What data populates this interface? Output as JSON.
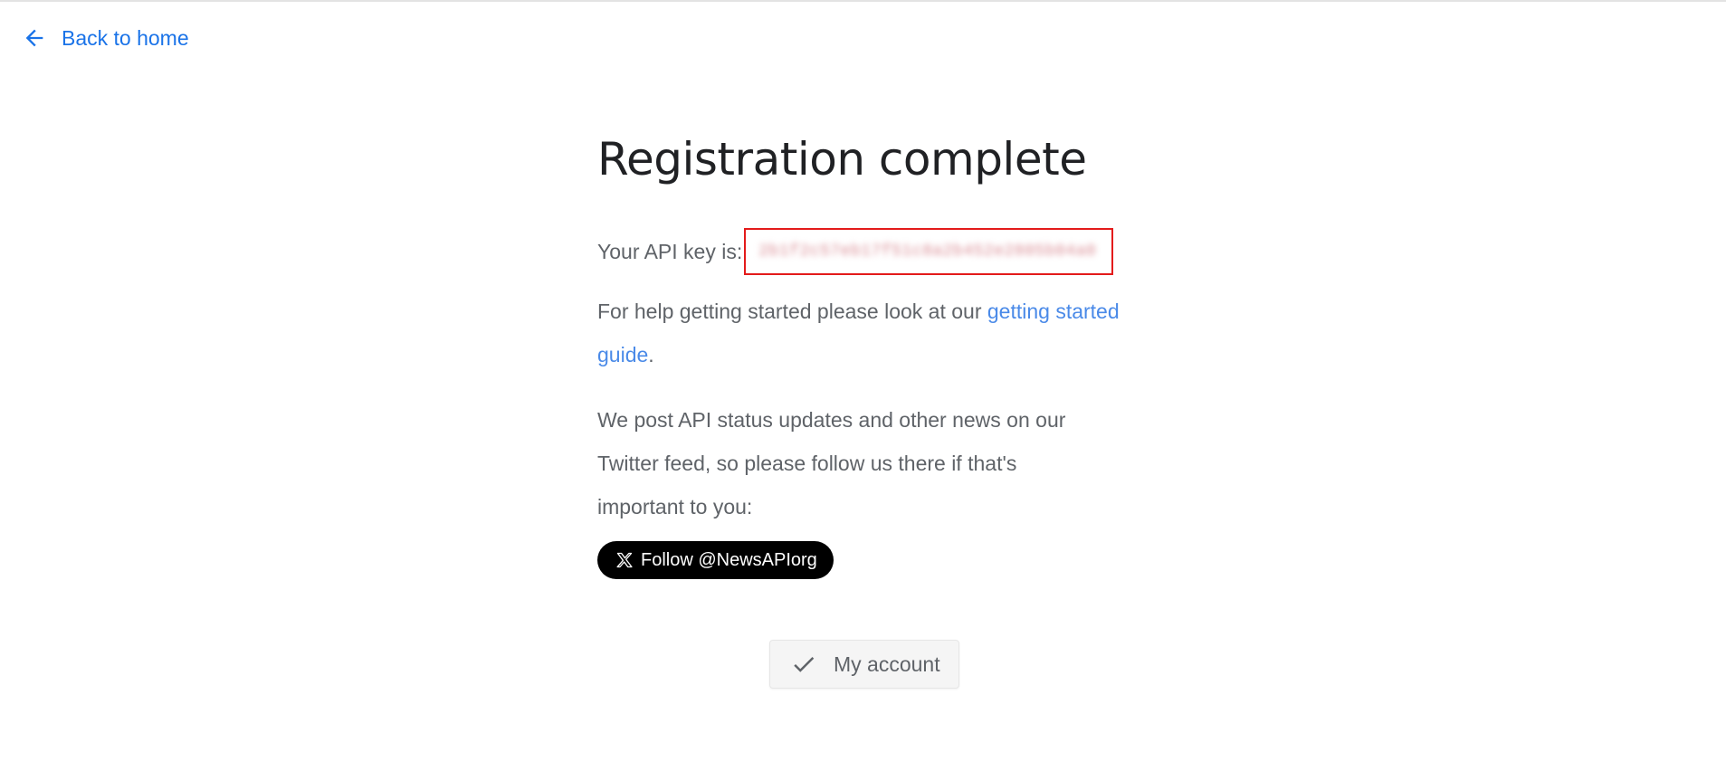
{
  "nav": {
    "back_label": "Back to home",
    "back_icon": "arrow-left-icon"
  },
  "main": {
    "title": "Registration complete",
    "api_key_label": "Your API key is:",
    "api_key_value": "2b1f2c57eb17f51c8a2b452e2805b04a0",
    "help_prefix": "For help getting started please look at our ",
    "help_link": "getting started guide",
    "help_suffix": ".",
    "news_text": "We post API status updates and other news on our Twitter feed, so please follow us there if that's important to you:",
    "follow_label": "Follow @NewsAPIorg",
    "follow_icon": "x-logo-icon",
    "account_label": "My account",
    "account_icon": "check-icon"
  },
  "colors": {
    "link": "#1a73e8",
    "highlight_border": "#e31b1b",
    "follow_bg": "#000000",
    "text": "#5f6368",
    "title": "#202124"
  }
}
